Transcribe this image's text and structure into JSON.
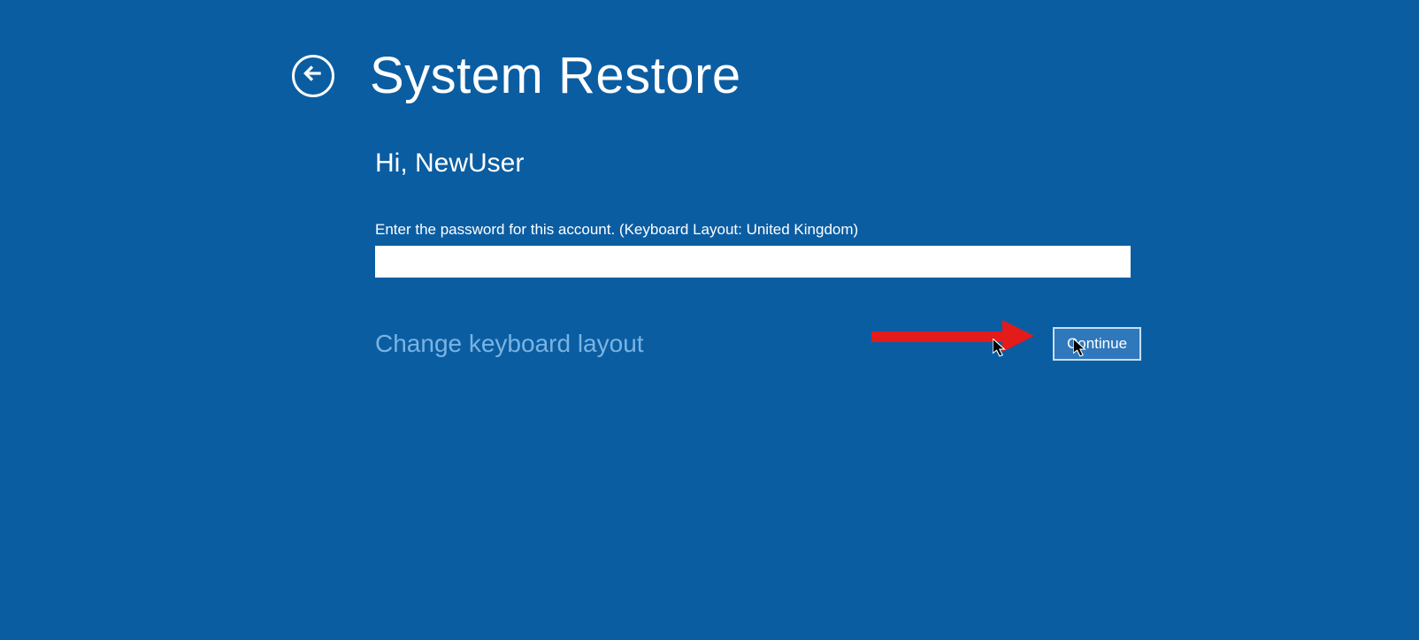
{
  "header": {
    "title": "System Restore"
  },
  "content": {
    "greeting": "Hi, NewUser",
    "password_label": "Enter the password for this account. (Keyboard Layout: United Kingdom)",
    "password_value": "",
    "change_keyboard": "Change keyboard layout",
    "continue_label": "Continue"
  }
}
